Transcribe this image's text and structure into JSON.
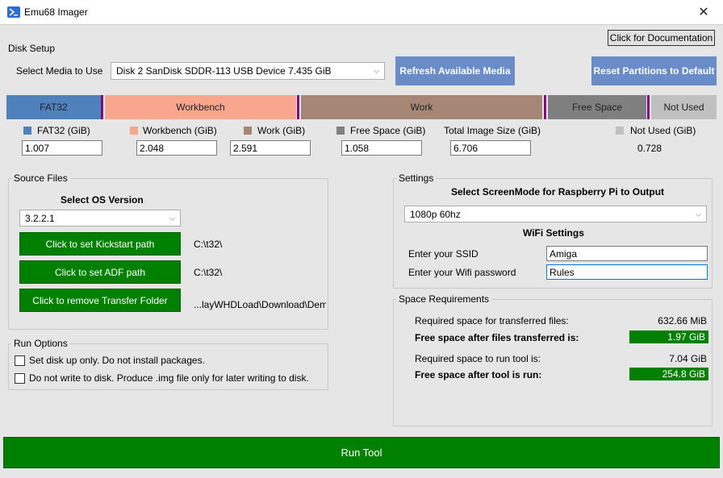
{
  "window": {
    "title": "Emu68 Imager",
    "close_glyph": "✕"
  },
  "header": {
    "documentation_button": "Click for Documentation"
  },
  "disk_setup": {
    "group_label": "Disk Setup",
    "select_media_label": "Select Media to Use",
    "media_value": "Disk 2 SanDisk SDDR-113 USB Device 7.435 GiB",
    "refresh_button": "Refresh Available Media",
    "reset_button": "Reset Partitions to Default",
    "partition_bar": {
      "fat32": "FAT32",
      "workbench": "Workbench",
      "work": "Work",
      "free_space": "Free Space",
      "not_used": "Not Used"
    },
    "sizes": {
      "fat32_label": "FAT32 (GiB)",
      "fat32_value": "1.007",
      "workbench_label": "Workbench (GiB)",
      "workbench_value": "2.048",
      "work_label": "Work (GiB)",
      "work_value": "2.591",
      "free_label": "Free Space (GiB)",
      "free_value": "1.058",
      "total_label": "Total Image Size (GiB)",
      "total_value": "6.706",
      "not_used_label": "Not Used (GiB)",
      "not_used_value": "0.728"
    },
    "colors": {
      "fat32": "#4f81bd",
      "workbench": "#f9a68f",
      "work": "#a68674",
      "free_space": "#7f7f7f",
      "not_used": "#c0c0c0",
      "divider": "#800080"
    }
  },
  "source_files": {
    "group_label": "Source Files",
    "os_version_title": "Select OS Version",
    "os_version_value": "3.2.2.1",
    "kickstart_button": "Click to set Kickstart path",
    "kickstart_path": "C:\\t32\\",
    "adf_button": "Click to set ADF path",
    "adf_path": "C:\\t32\\",
    "transfer_button": "Click to remove Transfer Folder",
    "transfer_path": "...layWHDLoad\\Download\\Dem"
  },
  "run_options": {
    "group_label": "Run Options",
    "option1": "Set disk up only. Do not install packages.",
    "option2": "Do not write to disk. Produce .img file only for later writing to disk."
  },
  "settings": {
    "group_label": "Settings",
    "screenmode_title": "Select ScreenMode for Raspberry Pi to Output",
    "screenmode_value": "1080p 60hz",
    "wifi_title": "WiFi Settings",
    "ssid_label": "Enter your SSID",
    "ssid_value": "Amiga",
    "password_label": "Enter your Wifi password",
    "password_value": "Rules"
  },
  "space": {
    "group_label": "Space Requirements",
    "required_transfer_label": "Required space for transferred files:",
    "required_transfer_value": "632.66 MiB",
    "free_after_transfer_label": "Free space after files transferred is:",
    "free_after_transfer_value": "1.97 GiB",
    "required_tool_label": "Required space to run tool is:",
    "required_tool_value": "7.04 GiB",
    "free_after_tool_label": "Free space after tool is run:",
    "free_after_tool_value": "254.8 GiB"
  },
  "run_tool_button": "Run Tool"
}
